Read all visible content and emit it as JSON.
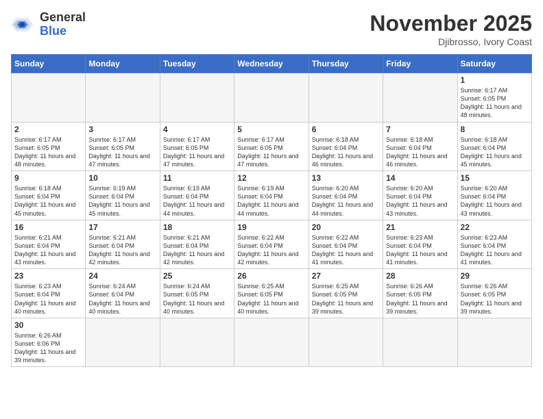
{
  "header": {
    "logo_general": "General",
    "logo_blue": "Blue",
    "month": "November 2025",
    "location": "Djibrosso, Ivory Coast"
  },
  "weekdays": [
    "Sunday",
    "Monday",
    "Tuesday",
    "Wednesday",
    "Thursday",
    "Friday",
    "Saturday"
  ],
  "weeks": [
    [
      {
        "day": null
      },
      {
        "day": null
      },
      {
        "day": null
      },
      {
        "day": null
      },
      {
        "day": null
      },
      {
        "day": null
      },
      {
        "day": 1,
        "sunrise": "Sunrise: 6:17 AM",
        "sunset": "Sunset: 6:05 PM",
        "daylight": "Daylight: 11 hours and 48 minutes."
      }
    ],
    [
      {
        "day": 2,
        "sunrise": "Sunrise: 6:17 AM",
        "sunset": "Sunset: 6:05 PM",
        "daylight": "Daylight: 11 hours and 48 minutes."
      },
      {
        "day": 3,
        "sunrise": "Sunrise: 6:17 AM",
        "sunset": "Sunset: 6:05 PM",
        "daylight": "Daylight: 11 hours and 47 minutes."
      },
      {
        "day": 4,
        "sunrise": "Sunrise: 6:17 AM",
        "sunset": "Sunset: 6:05 PM",
        "daylight": "Daylight: 11 hours and 47 minutes."
      },
      {
        "day": 5,
        "sunrise": "Sunrise: 6:17 AM",
        "sunset": "Sunset: 6:05 PM",
        "daylight": "Daylight: 11 hours and 47 minutes."
      },
      {
        "day": 6,
        "sunrise": "Sunrise: 6:18 AM",
        "sunset": "Sunset: 6:04 PM",
        "daylight": "Daylight: 11 hours and 46 minutes."
      },
      {
        "day": 7,
        "sunrise": "Sunrise: 6:18 AM",
        "sunset": "Sunset: 6:04 PM",
        "daylight": "Daylight: 11 hours and 46 minutes."
      },
      {
        "day": 8,
        "sunrise": "Sunrise: 6:18 AM",
        "sunset": "Sunset: 6:04 PM",
        "daylight": "Daylight: 11 hours and 45 minutes."
      }
    ],
    [
      {
        "day": 9,
        "sunrise": "Sunrise: 6:18 AM",
        "sunset": "Sunset: 6:04 PM",
        "daylight": "Daylight: 11 hours and 45 minutes."
      },
      {
        "day": 10,
        "sunrise": "Sunrise: 6:19 AM",
        "sunset": "Sunset: 6:04 PM",
        "daylight": "Daylight: 11 hours and 45 minutes."
      },
      {
        "day": 11,
        "sunrise": "Sunrise: 6:19 AM",
        "sunset": "Sunset: 6:04 PM",
        "daylight": "Daylight: 11 hours and 44 minutes."
      },
      {
        "day": 12,
        "sunrise": "Sunrise: 6:19 AM",
        "sunset": "Sunset: 6:04 PM",
        "daylight": "Daylight: 11 hours and 44 minutes."
      },
      {
        "day": 13,
        "sunrise": "Sunrise: 6:20 AM",
        "sunset": "Sunset: 6:04 PM",
        "daylight": "Daylight: 11 hours and 44 minutes."
      },
      {
        "day": 14,
        "sunrise": "Sunrise: 6:20 AM",
        "sunset": "Sunset: 6:04 PM",
        "daylight": "Daylight: 11 hours and 43 minutes."
      },
      {
        "day": 15,
        "sunrise": "Sunrise: 6:20 AM",
        "sunset": "Sunset: 6:04 PM",
        "daylight": "Daylight: 11 hours and 43 minutes."
      }
    ],
    [
      {
        "day": 16,
        "sunrise": "Sunrise: 6:21 AM",
        "sunset": "Sunset: 6:04 PM",
        "daylight": "Daylight: 11 hours and 43 minutes."
      },
      {
        "day": 17,
        "sunrise": "Sunrise: 6:21 AM",
        "sunset": "Sunset: 6:04 PM",
        "daylight": "Daylight: 11 hours and 42 minutes."
      },
      {
        "day": 18,
        "sunrise": "Sunrise: 6:21 AM",
        "sunset": "Sunset: 6:04 PM",
        "daylight": "Daylight: 11 hours and 42 minutes."
      },
      {
        "day": 19,
        "sunrise": "Sunrise: 6:22 AM",
        "sunset": "Sunset: 6:04 PM",
        "daylight": "Daylight: 11 hours and 42 minutes."
      },
      {
        "day": 20,
        "sunrise": "Sunrise: 6:22 AM",
        "sunset": "Sunset: 6:04 PM",
        "daylight": "Daylight: 11 hours and 41 minutes."
      },
      {
        "day": 21,
        "sunrise": "Sunrise: 6:23 AM",
        "sunset": "Sunset: 6:04 PM",
        "daylight": "Daylight: 11 hours and 41 minutes."
      },
      {
        "day": 22,
        "sunrise": "Sunrise: 6:23 AM",
        "sunset": "Sunset: 6:04 PM",
        "daylight": "Daylight: 11 hours and 41 minutes."
      }
    ],
    [
      {
        "day": 23,
        "sunrise": "Sunrise: 6:23 AM",
        "sunset": "Sunset: 6:04 PM",
        "daylight": "Daylight: 11 hours and 40 minutes."
      },
      {
        "day": 24,
        "sunrise": "Sunrise: 6:24 AM",
        "sunset": "Sunset: 6:04 PM",
        "daylight": "Daylight: 11 hours and 40 minutes."
      },
      {
        "day": 25,
        "sunrise": "Sunrise: 6:24 AM",
        "sunset": "Sunset: 6:05 PM",
        "daylight": "Daylight: 11 hours and 40 minutes."
      },
      {
        "day": 26,
        "sunrise": "Sunrise: 6:25 AM",
        "sunset": "Sunset: 6:05 PM",
        "daylight": "Daylight: 11 hours and 40 minutes."
      },
      {
        "day": 27,
        "sunrise": "Sunrise: 6:25 AM",
        "sunset": "Sunset: 6:05 PM",
        "daylight": "Daylight: 11 hours and 39 minutes."
      },
      {
        "day": 28,
        "sunrise": "Sunrise: 6:26 AM",
        "sunset": "Sunset: 6:05 PM",
        "daylight": "Daylight: 11 hours and 39 minutes."
      },
      {
        "day": 29,
        "sunrise": "Sunrise: 6:26 AM",
        "sunset": "Sunset: 6:05 PM",
        "daylight": "Daylight: 11 hours and 39 minutes."
      }
    ],
    [
      {
        "day": 30,
        "sunrise": "Sunrise: 6:26 AM",
        "sunset": "Sunset: 6:06 PM",
        "daylight": "Daylight: 11 hours and 39 minutes."
      },
      {
        "day": null
      },
      {
        "day": null
      },
      {
        "day": null
      },
      {
        "day": null
      },
      {
        "day": null
      },
      {
        "day": null
      }
    ]
  ]
}
